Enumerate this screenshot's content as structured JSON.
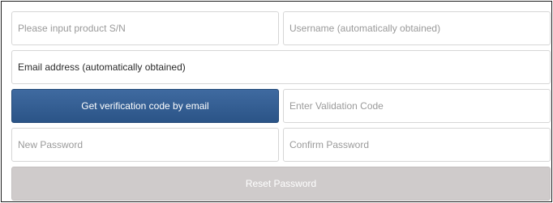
{
  "form": {
    "serial_placeholder": "Please input product S/N",
    "username_placeholder": "Username (automatically obtained)",
    "email_value": "Email address (automatically obtained)",
    "verify_button_label": "Get verification code by email",
    "validation_placeholder": "Enter Validation Code",
    "new_password_placeholder": "New Password",
    "confirm_password_placeholder": "Confirm Password",
    "reset_button_label": "Reset Password"
  },
  "colors": {
    "primary_button": "#2f5a8f",
    "disabled_button": "#cfcbcb",
    "field_border": "#d6d6d6"
  }
}
